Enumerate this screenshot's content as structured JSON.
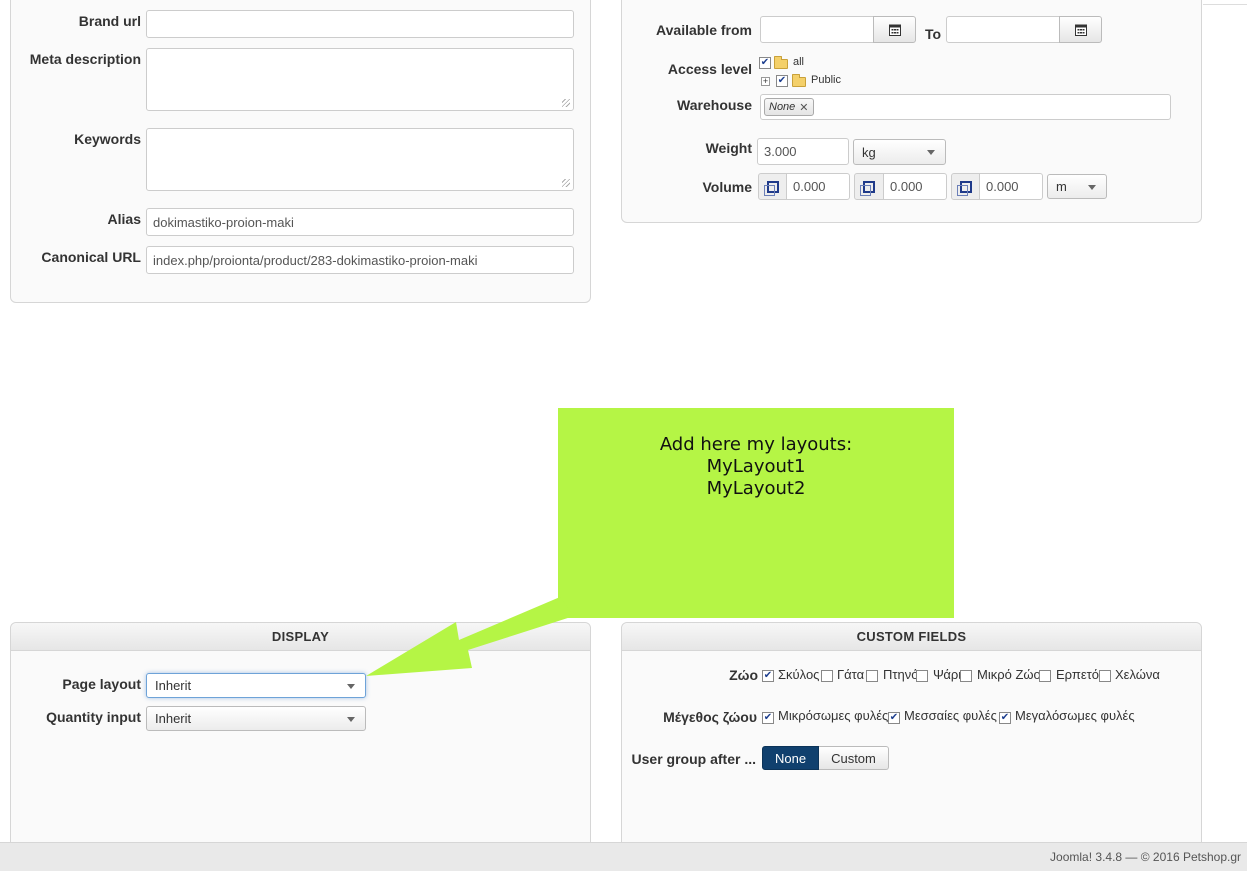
{
  "seo": {
    "brand_url_label": "Brand url",
    "brand_url_value": "",
    "meta_description_label": "Meta description",
    "keywords_label": "Keywords",
    "alias_label": "Alias",
    "alias_value": "dokimastiko-proion-maki",
    "canonical_label": "Canonical URL",
    "canonical_value": "index.php/proionta/product/283-dokimastiko-proion-maki"
  },
  "availability": {
    "available_from_label": "Available from",
    "to_label": "To",
    "access_level_label": "Access level",
    "access_tree": [
      {
        "label": "all",
        "checked": true
      },
      {
        "label": "Public",
        "checked": true
      }
    ],
    "warehouse_label": "Warehouse",
    "warehouse_tag": "None",
    "weight_label": "Weight",
    "weight_value": "3.000",
    "weight_unit": "kg",
    "volume_label": "Volume",
    "volume_values": [
      "0.000",
      "0.000",
      "0.000"
    ],
    "volume_unit": "m"
  },
  "callout": {
    "line1": "Add here my layouts:",
    "line2": "MyLayout1",
    "line3": "MyLayout2",
    "color": "#b5f545"
  },
  "display": {
    "header": "DISPLAY",
    "page_layout_label": "Page layout",
    "page_layout_value": "Inherit",
    "quantity_input_label": "Quantity input",
    "quantity_input_value": "Inherit"
  },
  "custom_fields": {
    "header": "CUSTOM FIELDS",
    "zoo_label": "Ζώο",
    "zoo_options": [
      {
        "label": "Σκύλος",
        "checked": true
      },
      {
        "label": "Γάτα",
        "checked": false
      },
      {
        "label": "Πτηνό",
        "checked": false
      },
      {
        "label": "Ψάρι",
        "checked": false
      },
      {
        "label": "Μικρό Ζώο",
        "checked": false
      },
      {
        "label": "Ερπετό",
        "checked": false
      },
      {
        "label": "Χελώνα",
        "checked": false
      }
    ],
    "size_label": "Μέγεθος ζώου",
    "size_options": [
      {
        "label": "Μικρόσωμες φυλές",
        "checked": true
      },
      {
        "label": "Μεσσαίες φυλές",
        "checked": true
      },
      {
        "label": "Μεγαλόσωμες φυλές",
        "checked": true
      }
    ],
    "user_group_label": "User group after ...",
    "user_group_options": [
      "None",
      "Custom"
    ],
    "accent_color": "#10406e"
  },
  "footer": {
    "text": "Joomla! 3.4.8  —  © 2016 Petshop.gr"
  }
}
